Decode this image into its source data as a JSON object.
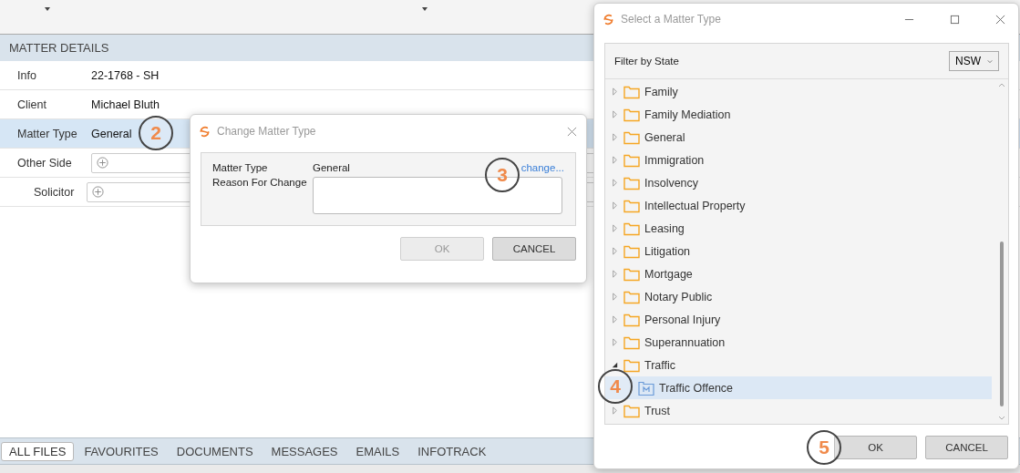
{
  "section_title": "MATTER DETAILS",
  "rows": [
    {
      "label": "Info",
      "kind": "text",
      "value": "22-1768 - SH",
      "selected": false
    },
    {
      "label": "Client",
      "kind": "text",
      "value": "Michael Bluth",
      "selected": false
    },
    {
      "label": "Matter Type",
      "kind": "text",
      "value": "General",
      "selected": true
    },
    {
      "label": "Other Side",
      "kind": "picker",
      "selected": false
    },
    {
      "label": "Solicitor",
      "kind": "picker",
      "selected": false
    }
  ],
  "bottom_tabs": [
    {
      "label": "ALL FILES",
      "selected": true
    },
    {
      "label": "FAVOURITES",
      "selected": false
    },
    {
      "label": "DOCUMENTS",
      "selected": false
    },
    {
      "label": "MESSAGES",
      "selected": false
    },
    {
      "label": "EMAILS",
      "selected": false
    },
    {
      "label": "INFOTRACK",
      "selected": false
    }
  ],
  "change_dialog": {
    "title": "Change Matter Type",
    "matter_type_label": "Matter Type",
    "matter_type_value": "General",
    "change_link": "change...",
    "reason_label": "Reason For Change",
    "buttons": [
      {
        "label": "OK",
        "disabled": true
      },
      {
        "label": "CANCEL",
        "disabled": false
      }
    ]
  },
  "select_dialog": {
    "title": "Select a Matter Type",
    "filter_label": "Filter by State",
    "filter_value": "NSW",
    "tree": [
      {
        "label": "Family",
        "kind": "folder",
        "expanded": false,
        "selected": false
      },
      {
        "label": "Family Mediation",
        "kind": "folder",
        "expanded": false,
        "selected": false
      },
      {
        "label": "General",
        "kind": "folder",
        "expanded": false,
        "selected": false
      },
      {
        "label": "Immigration",
        "kind": "folder",
        "expanded": false,
        "selected": false
      },
      {
        "label": "Insolvency",
        "kind": "folder",
        "expanded": false,
        "selected": false
      },
      {
        "label": "Intellectual Property",
        "kind": "folder",
        "expanded": false,
        "selected": false
      },
      {
        "label": "Leasing",
        "kind": "folder",
        "expanded": false,
        "selected": false
      },
      {
        "label": "Litigation",
        "kind": "folder",
        "expanded": false,
        "selected": false
      },
      {
        "label": "Mortgage",
        "kind": "folder",
        "expanded": false,
        "selected": false
      },
      {
        "label": "Notary Public",
        "kind": "folder",
        "expanded": false,
        "selected": false
      },
      {
        "label": "Personal Injury",
        "kind": "folder",
        "expanded": false,
        "selected": false
      },
      {
        "label": "Superannuation",
        "kind": "folder",
        "expanded": false,
        "selected": false
      },
      {
        "label": "Traffic",
        "kind": "folder",
        "expanded": true,
        "selected": false,
        "children": [
          {
            "label": "Traffic Offence",
            "kind": "matter-type",
            "selected": true
          }
        ]
      },
      {
        "label": "Trust",
        "kind": "folder",
        "expanded": false,
        "selected": false
      }
    ],
    "buttons": [
      {
        "label": "OK",
        "disabled": false
      },
      {
        "label": "CANCEL",
        "disabled": false
      }
    ]
  },
  "callouts": [
    {
      "label": "2"
    },
    {
      "label": "3"
    },
    {
      "label": "4"
    },
    {
      "label": "5"
    }
  ]
}
